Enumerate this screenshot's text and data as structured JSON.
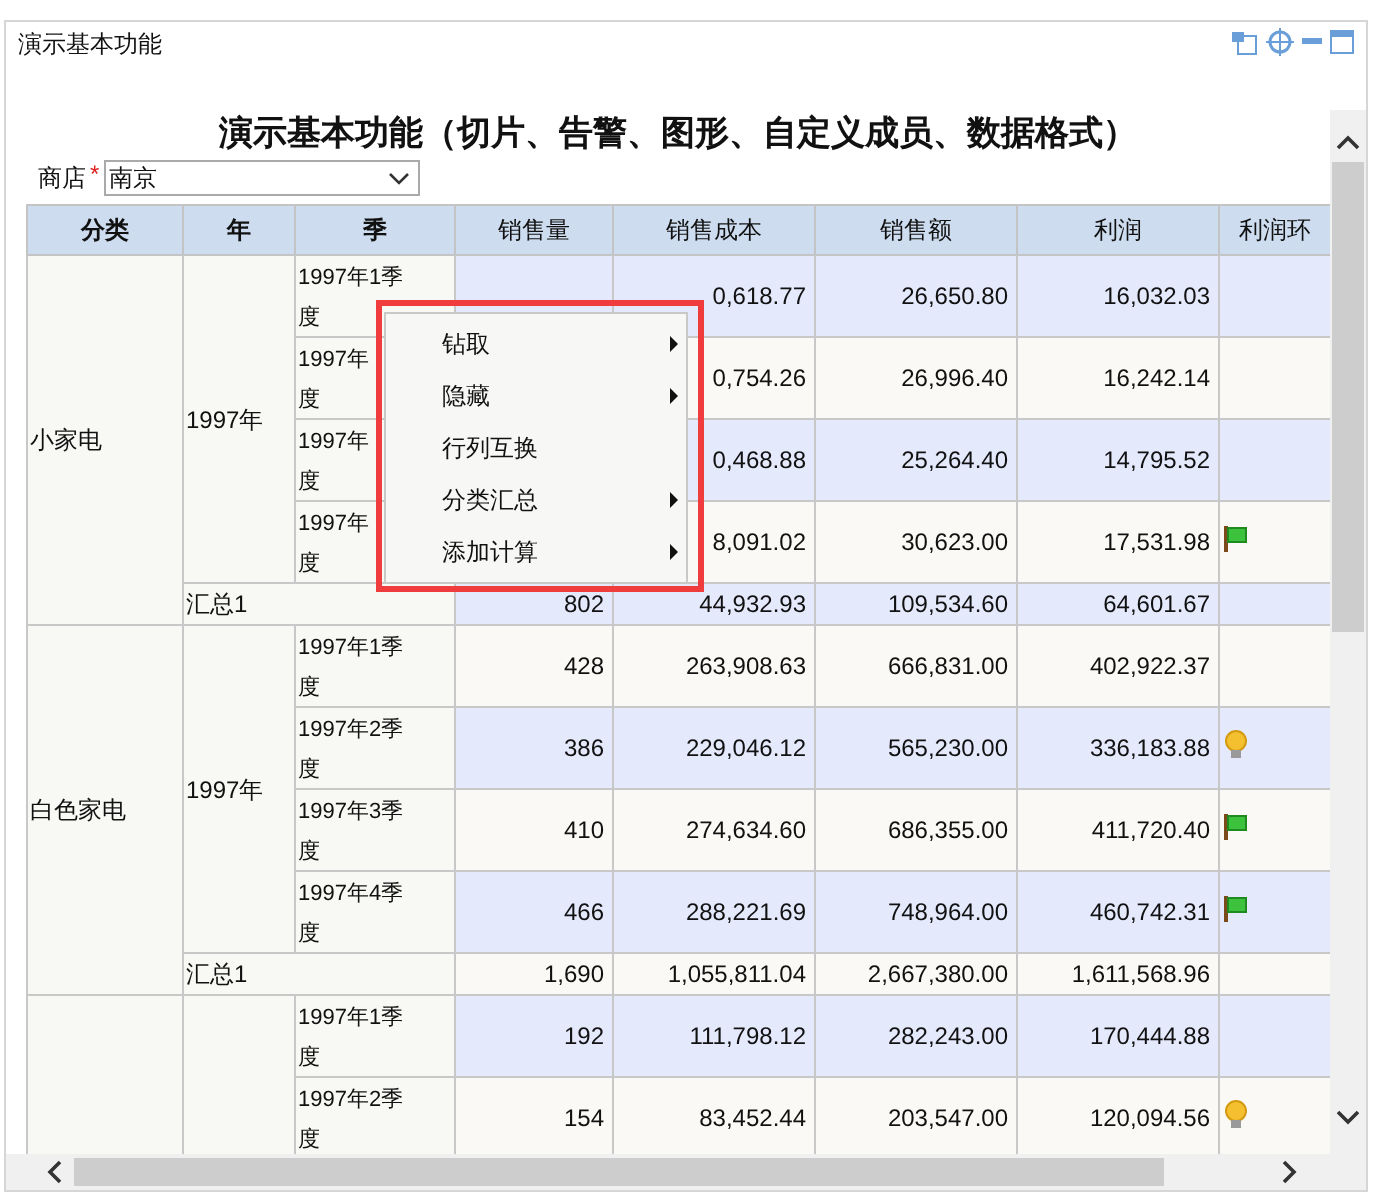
{
  "panel": {
    "title": "演示基本功能"
  },
  "report": {
    "title": "演示基本功能（切片、告警、图形、自定义成员、数据格式）",
    "filter": {
      "label": "商店",
      "required_mark": "*",
      "value": "南京"
    }
  },
  "table": {
    "columns": [
      "分类",
      "年",
      "季",
      "销售量",
      "销售成本",
      "销售额",
      "利润",
      "利润环"
    ],
    "groups": [
      {
        "category": "小家电",
        "year": "1997年",
        "rows": [
          {
            "quarter": [
              "1997年1季",
              "度"
            ],
            "cost": "0,618.77",
            "sales": "26,650.80",
            "profit": "16,032.03",
            "kind": "plain"
          },
          {
            "quarter": [
              "1997年",
              "度"
            ],
            "cost": "0,754.26",
            "sales": "26,996.40",
            "profit": "16,242.14",
            "kind": "plain"
          },
          {
            "quarter": [
              "1997年",
              "度"
            ],
            "cost": "0,468.88",
            "sales": "25,264.40",
            "profit": "14,795.52",
            "kind": "plain"
          },
          {
            "quarter": [
              "1997年",
              "度"
            ],
            "cost": "8,091.02",
            "sales": "30,623.00",
            "profit": "17,531.98",
            "kind": "flag"
          }
        ],
        "subtotal": {
          "label": "汇总1",
          "qty": "802",
          "cost": "44,932.93",
          "sales": "109,534.60",
          "profit": "64,601.67"
        }
      },
      {
        "category": "白色家电",
        "year": "1997年",
        "rows": [
          {
            "quarter": [
              "1997年1季",
              "度"
            ],
            "qty": "428",
            "cost": "263,908.63",
            "sales": "666,831.00",
            "profit": "402,922.37",
            "kind": "plain"
          },
          {
            "quarter": [
              "1997年2季",
              "度"
            ],
            "qty": "386",
            "cost": "229,046.12",
            "sales": "565,230.00",
            "profit": "336,183.88",
            "kind": "bulb"
          },
          {
            "quarter": [
              "1997年3季",
              "度"
            ],
            "qty": "410",
            "cost": "274,634.60",
            "sales": "686,355.00",
            "profit": "411,720.40",
            "kind": "flag"
          },
          {
            "quarter": [
              "1997年4季",
              "度"
            ],
            "qty": "466",
            "cost": "288,221.69",
            "sales": "748,964.00",
            "profit": "460,742.31",
            "kind": "flag"
          }
        ],
        "subtotal": {
          "label": "汇总1",
          "qty": "1,690",
          "cost": "1,055,811.04",
          "sales": "2,667,380.00",
          "profit": "1,611,568.96"
        }
      },
      {
        "rows": [
          {
            "quarter": [
              "1997年1季",
              "度"
            ],
            "qty": "192",
            "cost": "111,798.12",
            "sales": "282,243.00",
            "profit": "170,444.88",
            "kind": "plain"
          },
          {
            "quarter": [
              "1997年2季",
              "度"
            ],
            "qty": "154",
            "cost": "83,452.44",
            "sales": "203,547.00",
            "profit": "120,094.56",
            "kind": "bulb"
          }
        ]
      }
    ]
  },
  "context_menu": {
    "items": [
      {
        "label": "钻取",
        "submenu": true
      },
      {
        "label": "隐藏",
        "submenu": true
      },
      {
        "label": "行列互换",
        "submenu": false
      },
      {
        "label": "分类汇总",
        "submenu": true
      },
      {
        "label": "添加计算",
        "submenu": true
      }
    ]
  }
}
